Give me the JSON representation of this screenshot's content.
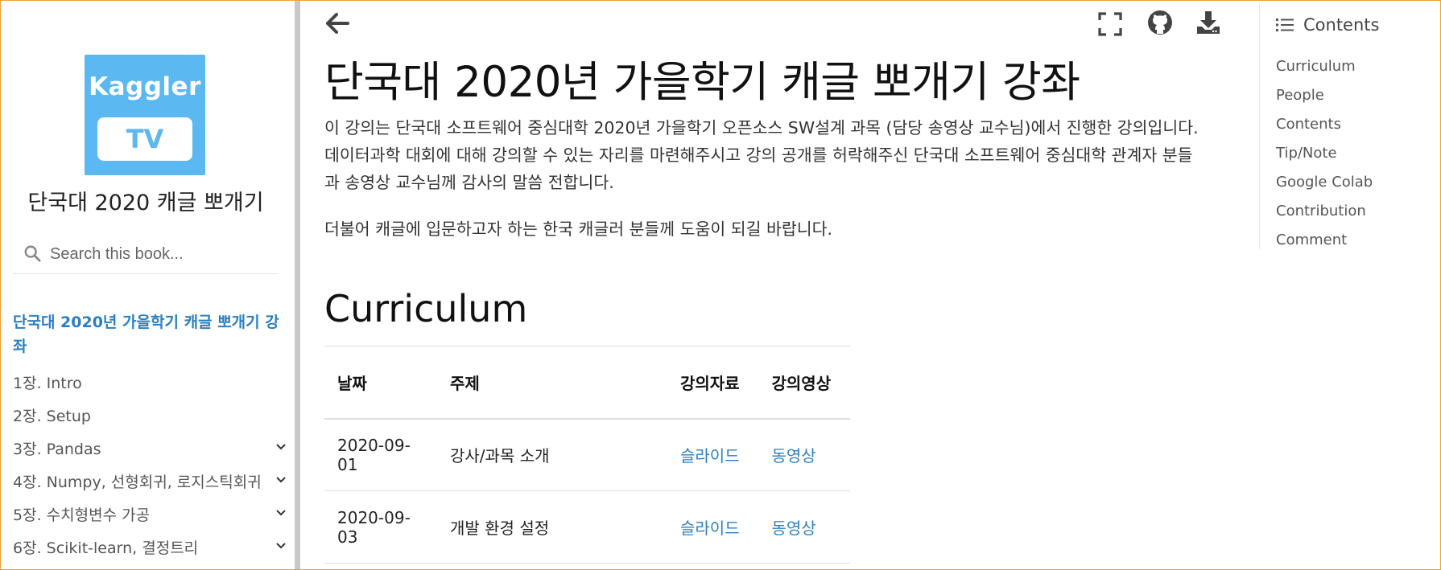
{
  "sidebar": {
    "logo": {
      "line1": "Kaggler",
      "line2": "TV",
      "bg_color": "#5bb8f0"
    },
    "book_title": "단국대 2020 캐글 뽀개기",
    "search": {
      "placeholder": "Search this book..."
    },
    "items": [
      {
        "label": "단국대 2020년 가을학기 캐글 뽀개기 강좌",
        "active": true
      },
      {
        "label": "1장. Intro"
      },
      {
        "label": "2장. Setup"
      },
      {
        "label": "3장. Pandas",
        "expandable": true
      },
      {
        "label": "4장. Numpy, 선형회귀, 로지스틱회귀",
        "expandable": true
      },
      {
        "label": "5장. 수치형변수 가공",
        "expandable": true
      },
      {
        "label": "6장. Scikit-learn, 결정트리",
        "expandable": true
      }
    ]
  },
  "header": {
    "icons": [
      "back-arrow-icon",
      "fullscreen-icon",
      "github-icon",
      "download-icon"
    ]
  },
  "main": {
    "title": "단국대 2020년 가을학기 캐글 뽀개기 강좌",
    "para1": "이 강의는 단국대 소프트웨어 중심대학 2020년 가을학기 오픈소스 SW설계 과목 (담당 송영상 교수님)에서 진행한 강의입니다. 데이터과학 대회에 대해 강의할 수 있는 자리를 마련해주시고 강의 공개를 허락해주신 단국대 소프트웨어 중심대학 관계자 분들과 송영상 교수님께 감사의 말씀 전합니다.",
    "para2": "더불어 캐글에 입문하고자 하는 한국 캐글러 분들께 도움이 되길 바랍니다.",
    "section_title": "Curriculum",
    "table": {
      "headers": [
        "날짜",
        "주제",
        "강의자료",
        "강의영상"
      ],
      "rows": [
        [
          "2020-09-01",
          "강사/과목 소개",
          "슬라이드",
          "동영상"
        ],
        [
          "2020-09-03",
          "개발 환경 설정",
          "슬라이드",
          "동영상"
        ]
      ]
    },
    "link_color": "#2c7fc0"
  },
  "toc": {
    "title": "Contents",
    "items": [
      "Curriculum",
      "People",
      "Contents",
      "Tip/Note",
      "Google Colab",
      "Contribution",
      "Comment"
    ]
  }
}
